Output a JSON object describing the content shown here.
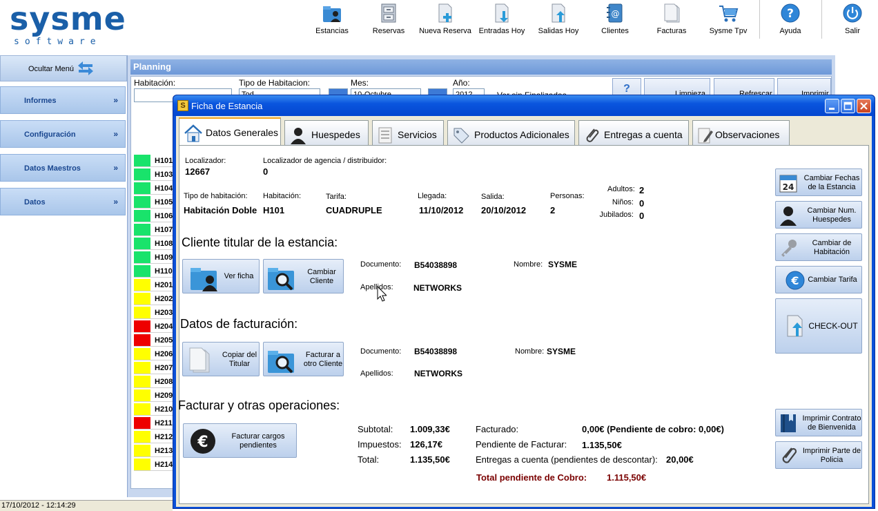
{
  "logo": {
    "main": "sysme",
    "sub": "software"
  },
  "toolbar": {
    "estancias": "Estancias",
    "reservas": "Reservas",
    "nueva_reserva": "Nueva Reserva",
    "entradas_hoy": "Entradas Hoy",
    "salidas_hoy": "Salidas Hoy",
    "clientes": "Clientes",
    "facturas": "Facturas",
    "sysme_tpv": "Sysme Tpv",
    "ayuda": "Ayuda",
    "salir": "Salir"
  },
  "sidebar": {
    "hide_menu": "Ocultar Menú",
    "sections": [
      "Informes",
      "Configuración",
      "Datos Maestros",
      "Datos"
    ]
  },
  "planning": {
    "title": "Planning",
    "habitacion_label": "Habitación:",
    "tipo_label": "Tipo de Habitacion:",
    "tipo_value": "Tod",
    "mes_label": "Mes:",
    "mes_value": "10-Octubre",
    "anio_label": "Año:",
    "anio_value": "2012",
    "checkbox_label": "Ver sin Finalizadas",
    "help_label": "?",
    "limpieza": "Limpieza",
    "refrescar": "Refrescar",
    "imprimir": "Imprimir",
    "colors": {
      "green": "#19e36b",
      "yellow": "#ffff00",
      "red": "#ee0000"
    },
    "rooms": [
      {
        "label": "H101",
        "status": "green"
      },
      {
        "label": "H103",
        "status": "green"
      },
      {
        "label": "H104",
        "status": "green"
      },
      {
        "label": "H105",
        "status": "green"
      },
      {
        "label": "H106",
        "status": "green"
      },
      {
        "label": "H107",
        "status": "green"
      },
      {
        "label": "H108",
        "status": "green"
      },
      {
        "label": "H109",
        "status": "green"
      },
      {
        "label": "H110",
        "status": "green"
      },
      {
        "label": "H201",
        "status": "yellow"
      },
      {
        "label": "H202",
        "status": "yellow"
      },
      {
        "label": "H203",
        "status": "yellow"
      },
      {
        "label": "H204",
        "status": "red"
      },
      {
        "label": "H205",
        "status": "red"
      },
      {
        "label": "H206",
        "status": "yellow"
      },
      {
        "label": "H207",
        "status": "yellow"
      },
      {
        "label": "H208",
        "status": "yellow"
      },
      {
        "label": "H209",
        "status": "yellow"
      },
      {
        "label": "H210",
        "status": "yellow"
      },
      {
        "label": "H211",
        "status": "red"
      },
      {
        "label": "H212",
        "status": "yellow"
      },
      {
        "label": "H213",
        "status": "yellow"
      },
      {
        "label": "H214",
        "status": "yellow"
      }
    ]
  },
  "statusbar": {
    "datetime": "17/10/2012 - 12:14:29"
  },
  "modal": {
    "title": "Ficha de Estancia",
    "tabs": [
      "Datos Generales",
      "Huespedes",
      "Servicios",
      "Productos Adicionales",
      "Entregas a cuenta",
      "Observaciones"
    ],
    "localizador_label": "Localizador:",
    "localizador_value": "12667",
    "agencia_label": "Localizador de agencia / distribuidor:",
    "agencia_value": "0",
    "tipo_hab_label": "Tipo de habitación:",
    "tipo_hab_value": "Habitación Doble",
    "habitacion_label": "Habitación:",
    "habitacion_value": "H101",
    "tarifa_label": "Tarifa:",
    "tarifa_value": "CUADRUPLE",
    "llegada_label": "Llegada:",
    "llegada_value": "11/10/2012",
    "salida_label": "Salida:",
    "salida_value": "20/10/2012",
    "personas_label": "Personas:",
    "personas_value": "2",
    "adultos_label": "Adultos:",
    "adultos_value": "2",
    "ninos_label": "Niños:",
    "ninos_value": "0",
    "jubilados_label": "Jubilados:",
    "jubilados_value": "0",
    "cliente_header": "Cliente titular de la estancia:",
    "ver_ficha": "Ver ficha",
    "cambiar_cliente": "Cambiar Cliente",
    "documento_label": "Documento:",
    "documento_value": "B54038898",
    "nombre_label": "Nombre:",
    "nombre_value": "SYSME",
    "apellidos_label": "Apellidos:",
    "apellidos_value": "NETWORKS",
    "facturacion_header": "Datos de facturación:",
    "copiar_titular": "Copiar del Titular",
    "facturar_otro": "Facturar a otro Cliente",
    "fact_documento_value": "B54038898",
    "fact_nombre_value": "SYSME",
    "fact_apellidos_value": "NETWORKS",
    "operaciones_header": "Facturar y otras operaciones:",
    "facturar_cargos": "Facturar cargos pendientes",
    "subtotal_label": "Subtotal:",
    "subtotal_value": "1.009,33€",
    "impuestos_label": "Impuestos:",
    "impuestos_value": "126,17€",
    "total_label": "Total:",
    "total_value": "1.135,50€",
    "facturado_label": "Facturado:",
    "facturado_value": "0,00€ (Pendiente de cobro: 0,00€)",
    "pendiente_facturar_label": "Pendiente de Facturar:",
    "pendiente_facturar_value": "1.135,50€",
    "entregas_label": "Entregas a cuenta (pendientes de descontar):",
    "entregas_value": "20,00€",
    "total_pendiente_label": "Total pendiente de Cobro:",
    "total_pendiente_value": "1.115,50€",
    "cambiar_fechas": "Cambiar Fechas de la Estancia",
    "cambiar_huespedes": "Cambiar Num. Huespedes",
    "cambiar_habitacion": "Cambiar de Habitación",
    "cambiar_tarifa": "Cambiar Tarifa",
    "checkout": "CHECK-OUT",
    "imprimir_contrato": "Imprimir Contrato de Bienvenida",
    "imprimir_policia": "Imprimir Parte de Policia"
  }
}
